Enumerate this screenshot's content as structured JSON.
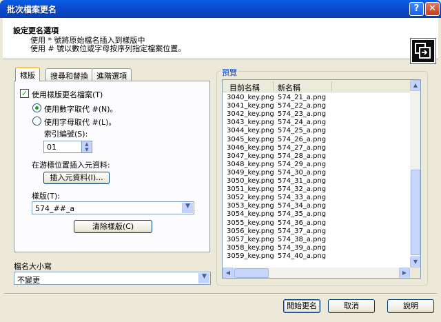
{
  "window": {
    "title": "批次檔案更名",
    "help_label": "?",
    "close_label": "✕"
  },
  "header": {
    "title": "設定更名選項",
    "line1": "使用 * 號將原始檔名插入到樣版中",
    "line2": "使用 # 號以數位或字母按序列指定檔案位置。",
    "icon": "rename-files-icon"
  },
  "tabs": [
    {
      "label": "樣版",
      "active": true
    },
    {
      "label": "搜尋和替換",
      "active": false
    },
    {
      "label": "進階選項",
      "active": false
    }
  ],
  "template_tab": {
    "use_template_label": "使用樣版更名檔案(T)",
    "use_template_checked": true,
    "radio_digits_label": "使用數字取代 #(N)。",
    "radio_digits_selected": true,
    "radio_letters_label": "使用字母取代 #(L)。",
    "radio_letters_selected": false,
    "index_label": "索引編號(S):",
    "index_value": "01",
    "insert_meta_label": "在游標位置插入元資料:",
    "insert_meta_button": "插入元資料(I)...",
    "template_label": "樣版(T):",
    "template_value": "574_##_a",
    "clear_template_button": "清除樣版(C)"
  },
  "case": {
    "label": "檔名大小寫",
    "value": "不變更"
  },
  "preview": {
    "label": "預覽",
    "columns": [
      "目前名稱",
      "新名稱"
    ],
    "rows": [
      [
        "3040_key.png",
        "574_21_a.png"
      ],
      [
        "3041_key.png",
        "574_22_a.png"
      ],
      [
        "3042_key.png",
        "574_23_a.png"
      ],
      [
        "3043_key.png",
        "574_24_a.png"
      ],
      [
        "3044_key.png",
        "574_25_a.png"
      ],
      [
        "3045_key.png",
        "574_26_a.png"
      ],
      [
        "3046_key.png",
        "574_27_a.png"
      ],
      [
        "3047_key.png",
        "574_28_a.png"
      ],
      [
        "3048_key.png",
        "574_29_a.png"
      ],
      [
        "3049_key.png",
        "574_30_a.png"
      ],
      [
        "3050_key.png",
        "574_31_a.png"
      ],
      [
        "3051_key.png",
        "574_32_a.png"
      ],
      [
        "3052_key.png",
        "574_33_a.png"
      ],
      [
        "3053_key.png",
        "574_34_a.png"
      ],
      [
        "3054_key.png",
        "574_35_a.png"
      ],
      [
        "3055_key.png",
        "574_36_a.png"
      ],
      [
        "3056_key.png",
        "574_37_a.png"
      ],
      [
        "3057_key.png",
        "574_38_a.png"
      ],
      [
        "3058_key.png",
        "574_39_a.png"
      ],
      [
        "3059_key.png",
        "574_40_a.png"
      ]
    ]
  },
  "buttons": {
    "start": "開始更名",
    "cancel": "取消",
    "help": "說明"
  },
  "colors": {
    "titlebar": "#0b4cd1",
    "group_label": "#0046d5",
    "check": "#21a121"
  }
}
